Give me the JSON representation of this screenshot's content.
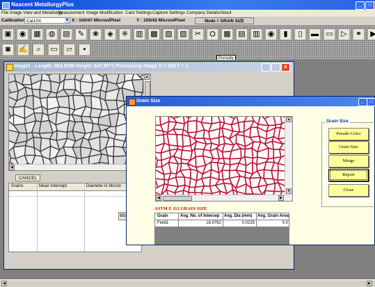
{
  "app": {
    "title": "Nascent MetallurgyPlus"
  },
  "menu": [
    "File",
    "Image View and Metallurgy",
    "Measurement",
    "Image Modification",
    "Card Settings",
    "Capture Settings",
    "Company Details",
    "About"
  ],
  "calibration": {
    "label": "Calibration",
    "value": "Cal10X",
    "x_readout": "X : 100/47  Micron/Pixel",
    "y_readout": "Y : 100/42  Micron/Pixel",
    "mode": "Mode = GRAIN SIZE"
  },
  "toolbar": {
    "tooltip": "Porosity",
    "row1_icons": [
      "image-open-icon",
      "magnify-icon",
      "grain-icon",
      "globe-icon",
      "rgb-icon",
      "edit-chart-icon",
      "flower-icon",
      "phase-icon",
      "particle-icon",
      "histogram-icon",
      "picture-icon",
      "film-icon",
      "scale-icon",
      "scissors-icon",
      "porosity-icon",
      "grid-icon",
      "layout-icon",
      "graph-icon",
      "eye-icon",
      "color-bars-icon",
      "document-icon",
      "notes-icon",
      "report-icon",
      "send-icon",
      "chain-icon",
      "export-icon"
    ],
    "row2_icons": [
      "camera-icon",
      "brush-icon",
      "zoom-icon",
      "folder-icon",
      "open-folder-icon",
      "save-icon"
    ]
  },
  "image_window": {
    "title": "Image1 - Length: 863.8298 Height :647.8571 Processing Image  X =  155  Y =  1",
    "cancel_label": "CANCEL",
    "columns": [
      "Grains",
      "Mean Intercept",
      "Diameter  in Micron"
    ],
    "hidden_button": "BEF"
  },
  "grain_window": {
    "title": "Grain Size",
    "group_label": "Grain Size",
    "buttons": [
      "Pseudo Color",
      "Grain Size",
      "Merge",
      "Report",
      "Close"
    ],
    "astm_title": "ASTM E 112  GRAIN SIZE",
    "table_columns": [
      "Grain",
      "Avg. No. of Intercep",
      "Avg. Dia (mm)",
      "Avg. Grain Area (n"
    ],
    "table_rows": [
      [
        "Feild1",
        "18.9762",
        "0.0225",
        "0.0"
      ]
    ]
  },
  "colors": {
    "title_blue": "#0a46d8",
    "grain_boundary": "#c0143c",
    "button_yellow": "#ffff99",
    "astm_red": "#cc0000"
  }
}
